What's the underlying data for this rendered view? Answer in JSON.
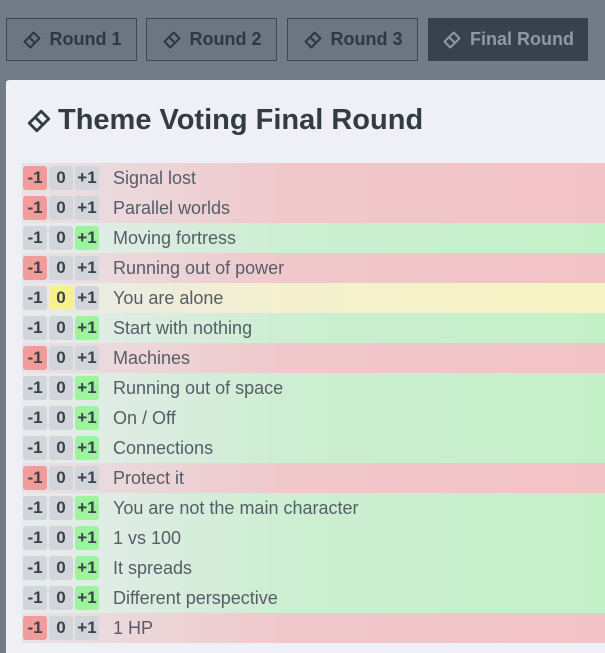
{
  "tabs": [
    {
      "label": "Round 1"
    },
    {
      "label": "Round 2"
    },
    {
      "label": "Round 3"
    },
    {
      "label": "Final Round"
    }
  ],
  "active_tab": "Final Round",
  "page_title": "Theme Voting Final Round",
  "vote_buttons": {
    "minus": "-1",
    "zero": "0",
    "plus": "+1"
  },
  "themes": [
    {
      "label": "Signal lost",
      "vote": "-1"
    },
    {
      "label": "Parallel worlds",
      "vote": "-1"
    },
    {
      "label": "Moving fortress",
      "vote": "+1"
    },
    {
      "label": "Running out of power",
      "vote": "-1"
    },
    {
      "label": "You are alone",
      "vote": "0"
    },
    {
      "label": "Start with nothing",
      "vote": "+1"
    },
    {
      "label": "Machines",
      "vote": "-1"
    },
    {
      "label": "Running out of space",
      "vote": "+1"
    },
    {
      "label": "On / Off",
      "vote": "+1"
    },
    {
      "label": "Connections",
      "vote": "+1"
    },
    {
      "label": "Protect it",
      "vote": "-1"
    },
    {
      "label": "You are not the main character",
      "vote": "+1"
    },
    {
      "label": "1 vs 100",
      "vote": "+1"
    },
    {
      "label": "It spreads",
      "vote": "+1"
    },
    {
      "label": "Different perspective",
      "vote": "+1"
    },
    {
      "label": "1 HP",
      "vote": "-1"
    }
  ],
  "colors": {
    "vote_minus": "#f29b9b",
    "vote_zero": "#f6f08e",
    "vote_plus": "#9cf49c",
    "header_bg": "#727c87",
    "active_tab_bg": "#38424d"
  },
  "icons": {
    "tab_icon": "ticket-icon",
    "title_icon": "ticket-icon"
  }
}
